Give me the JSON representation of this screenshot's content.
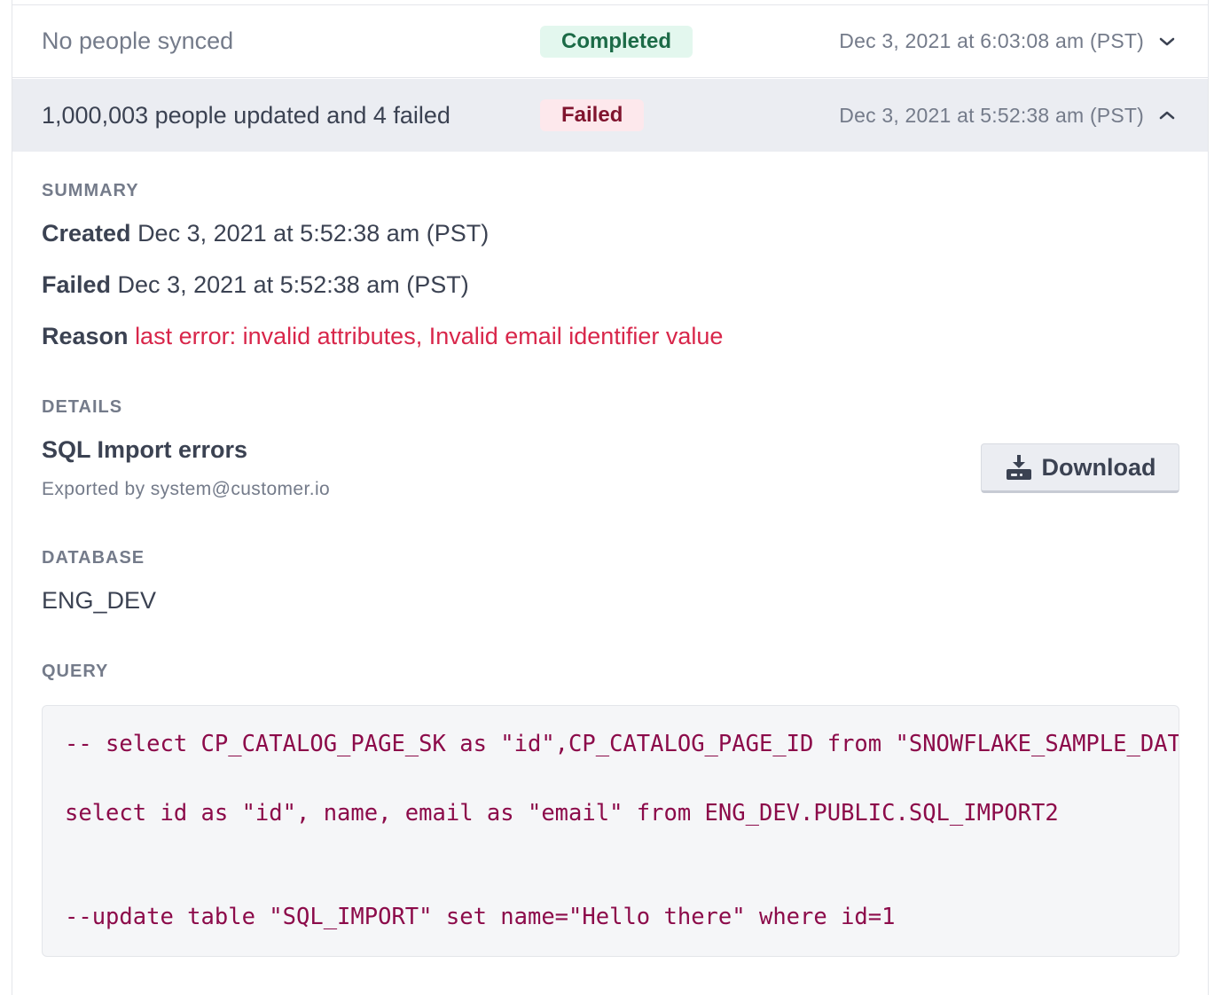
{
  "rows": [
    {
      "title": "No people synced",
      "status": "Completed",
      "date": "Dec 3, 2021 at 6:03:08 am (PST)",
      "expanded": false
    },
    {
      "title": "1,000,003 people updated and 4 failed",
      "status": "Failed",
      "date": "Dec 3, 2021 at 5:52:38 am (PST)",
      "expanded": true
    }
  ],
  "summary": {
    "label": "SUMMARY",
    "created_label": "Created",
    "created_value": "Dec 3, 2021 at 5:52:38 am (PST)",
    "failed_label": "Failed",
    "failed_value": "Dec 3, 2021 at 5:52:38 am (PST)",
    "reason_label": "Reason",
    "reason_value": "last error: invalid attributes, Invalid email identifier value"
  },
  "details": {
    "label": "DETAILS",
    "title": "SQL Import errors",
    "exported_by": "Exported by system@customer.io",
    "download_label": "Download"
  },
  "database": {
    "label": "DATABASE",
    "value": "ENG_DEV"
  },
  "query": {
    "label": "QUERY",
    "lines": [
      "-- select CP_CATALOG_PAGE_SK as \"id\",CP_CATALOG_PAGE_ID from \"SNOWFLAKE_SAMPLE_DATA\"",
      "select id as \"id\", name, email as \"email\" from ENG_DEV.PUBLIC.SQL_IMPORT2",
      "--update table \"SQL_IMPORT\" set name=\"Hello there\" where id=1"
    ]
  },
  "colors": {
    "completed_bg": "#e3f7ee",
    "completed_text": "#1c6b47",
    "failed_bg": "#fde8ec",
    "failed_text": "#80142e",
    "error_text": "#d8264a",
    "code_text": "#8c0b4a"
  },
  "icons": {
    "row_collapsed": "chevron-down-icon",
    "row_expanded": "chevron-up-icon",
    "download": "download-icon"
  }
}
